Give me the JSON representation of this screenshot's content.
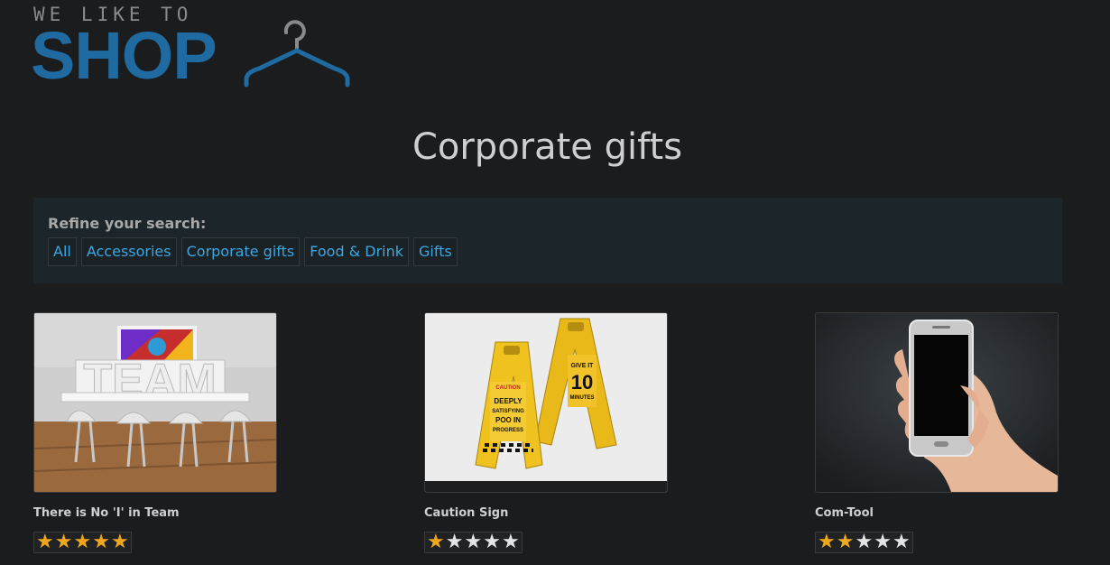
{
  "logo": {
    "tagline": "WE LIKE TO",
    "wordmark": "SHOP",
    "icon": "hanger-icon",
    "color": "#1f6aa0"
  },
  "page": {
    "title": "Corporate gifts"
  },
  "refine": {
    "label": "Refine your search:",
    "filters": [
      "All",
      "Accessories",
      "Corporate gifts",
      "Food & Drink",
      "Gifts"
    ]
  },
  "products": [
    {
      "name": "There is No 'I' in Team",
      "rating": 5,
      "max_rating": 5,
      "image": "team-meeting-room-image"
    },
    {
      "name": "Caution Sign",
      "rating": 1,
      "max_rating": 5,
      "image": "caution-sign-image",
      "image_text": {
        "sign1": [
          "CAUTION",
          "DEEPLY",
          "SATISFYING",
          "POO IN",
          "PROGRESS"
        ],
        "sign2": [
          "GIVE IT",
          "10",
          "MINUTES"
        ]
      }
    },
    {
      "name": "Com-Tool",
      "rating": 2,
      "max_rating": 5,
      "image": "smartphone-hand-image"
    }
  ],
  "colors": {
    "link": "#3da6e0",
    "star_on": "#f0a81a",
    "star_off": "#e4e4e4",
    "background": "#1b1c1e"
  }
}
